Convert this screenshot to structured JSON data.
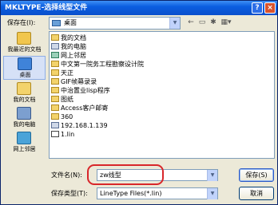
{
  "window": {
    "title": "MKLTYPE-选择线型文件",
    "help_label": "?",
    "close_label": "×"
  },
  "lookin": {
    "label": "保存在(I):",
    "value": "桌面",
    "arrow": "▼"
  },
  "toolbar": {
    "back": "←",
    "up": "▭",
    "newfolder": "✱",
    "views": "▦▾"
  },
  "places": [
    {
      "label": "我最近的文档",
      "color": "#f1c64d"
    },
    {
      "label": "桌面",
      "color": "#3f83d9"
    },
    {
      "label": "我的文档",
      "color": "#f3d36b"
    },
    {
      "label": "我的电脑",
      "color": "#7c9fcf"
    },
    {
      "label": "网上邻居",
      "color": "#4aa3d8"
    }
  ],
  "files": [
    {
      "name": "我的文档",
      "kind": "folder"
    },
    {
      "name": "我的电脑",
      "kind": "sys"
    },
    {
      "name": "网上邻居",
      "kind": "net"
    },
    {
      "name": "中文第一院务工程勘察设计院",
      "kind": "folder"
    },
    {
      "name": "天正",
      "kind": "folder"
    },
    {
      "name": "GIF帧幕录录",
      "kind": "folder"
    },
    {
      "name": "中治置业lisp程序",
      "kind": "folder"
    },
    {
      "name": "图纸",
      "kind": "folder"
    },
    {
      "name": "Access客户邮寄",
      "kind": "folder"
    },
    {
      "name": "360",
      "kind": "folder"
    },
    {
      "name": "192.168.1.139",
      "kind": "sys"
    },
    {
      "name": "1.lin",
      "kind": "file"
    }
  ],
  "filename": {
    "label": "文件名(N):",
    "value": "zw线型",
    "arrow": "▼"
  },
  "filetype": {
    "label": "保存类型(T):",
    "value": "LineType Files(*.lin)",
    "arrow": "▼"
  },
  "buttons": {
    "save": "保存(S)",
    "cancel": "取消"
  },
  "colors": {
    "highlight": "#d8262a",
    "titlebar": "#0b5ee0"
  }
}
